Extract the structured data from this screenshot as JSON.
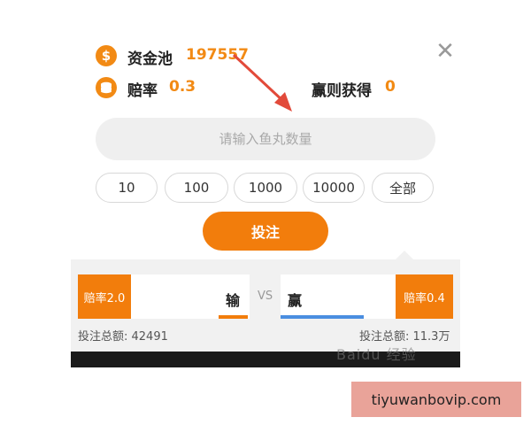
{
  "header": {
    "pool_label": "资金池",
    "pool_value": "197557",
    "odds_label": "赔率",
    "odds_value": "0.3",
    "win_label": "赢则获得",
    "win_value": "0",
    "close_symbol": "✕"
  },
  "input": {
    "placeholder": "请输入鱼丸数量"
  },
  "chips": [
    "10",
    "100",
    "1000",
    "10000",
    "全部"
  ],
  "bet_button": {
    "label": "投注"
  },
  "match": {
    "left_odds": "赔率2.0",
    "left_side": "输",
    "vs": "VS",
    "right_side": "赢",
    "right_odds": "赔率0.4",
    "left_total": "投注总额: 42491",
    "right_total": "投注总额: 11.3万"
  },
  "watermark": {
    "text": "Baidu 经验"
  },
  "footer": {
    "url": "tiyuwanbovip.com"
  },
  "colors": {
    "accent": "#f27d0c",
    "blue": "#4a8ee0",
    "url_bg": "#e9a399"
  },
  "icons": {
    "pool": "dollar-coin-icon",
    "odds": "coin-stack-icon",
    "close": "close-icon"
  }
}
